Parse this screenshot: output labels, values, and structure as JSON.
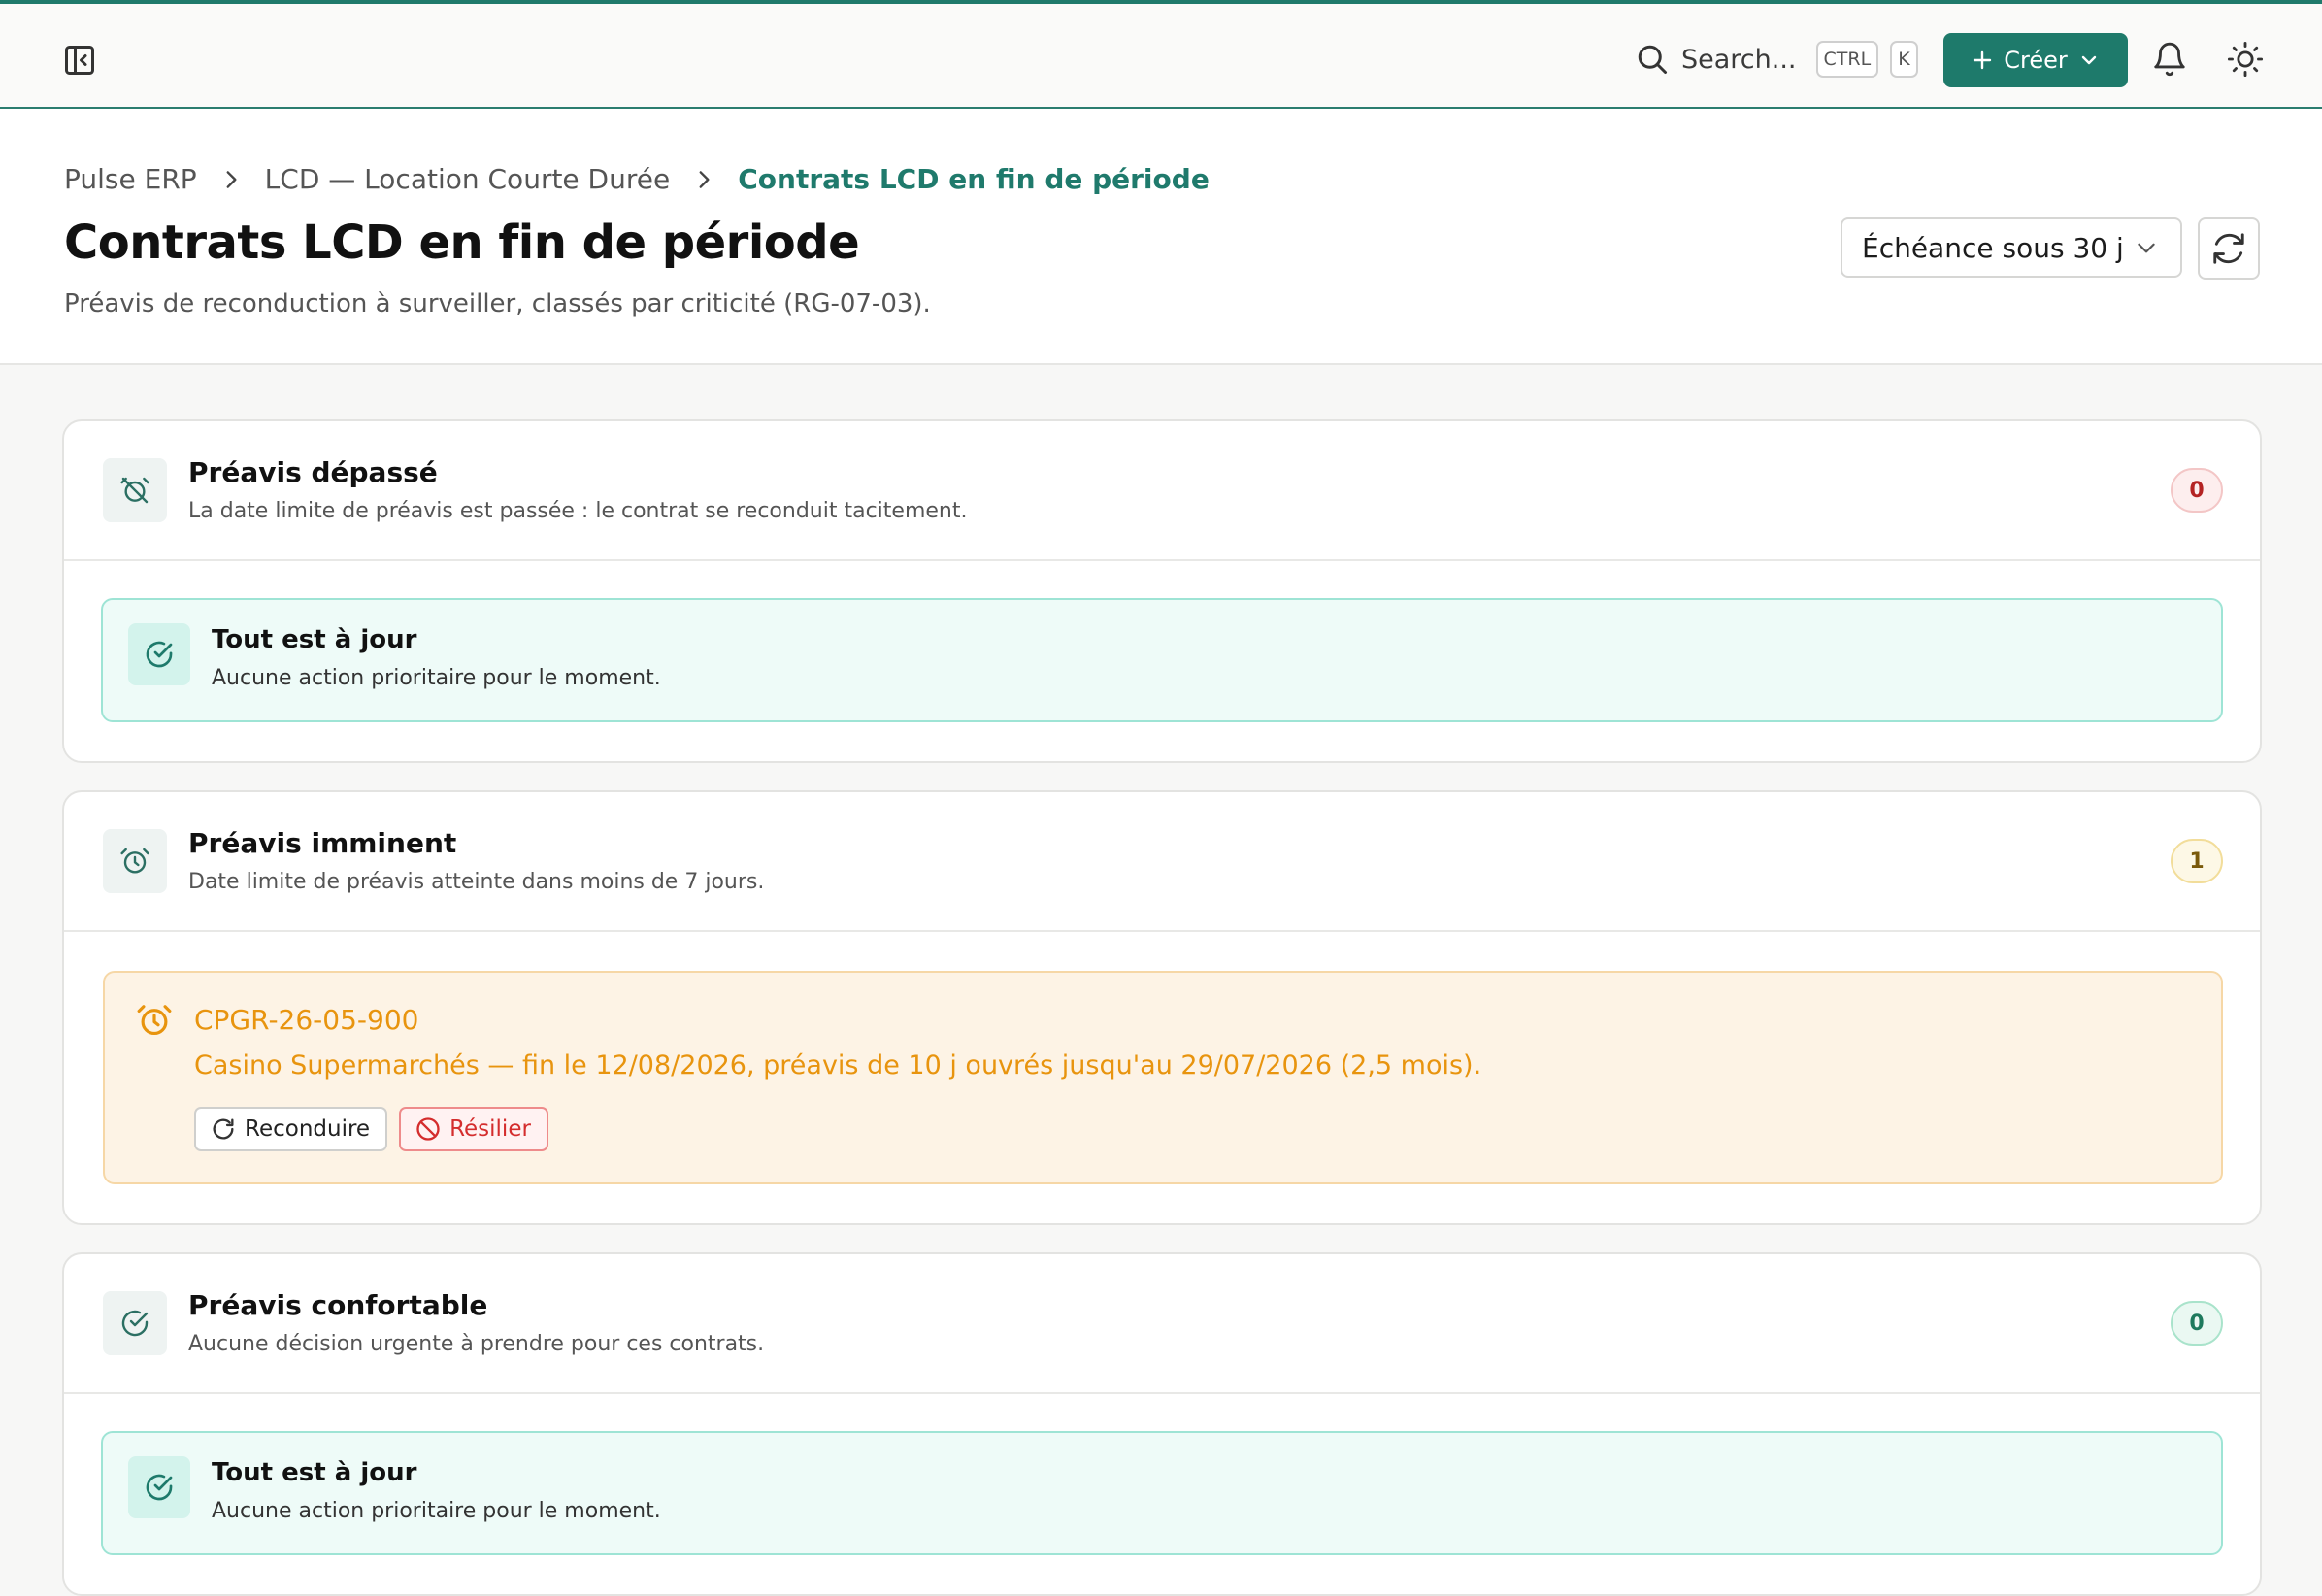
{
  "topbar": {
    "search_label": "Search...",
    "shortcut_key1": "CTRL",
    "shortcut_key2": "K",
    "create_label": "Créer"
  },
  "breadcrumb": {
    "items": [
      "Pulse ERP",
      "LCD — Location Courte Durée",
      "Contrats LCD en fin de période"
    ]
  },
  "page": {
    "title": "Contrats LCD en fin de période",
    "subtitle": "Préavis de reconduction à surveiller, classés par criticité (RG-07-03).",
    "period_filter": "Échéance sous 30 j"
  },
  "sections": [
    {
      "title": "Préavis dépassé",
      "description": "La date limite de préavis est passée : le contrat se reconduit tacitement.",
      "count": "0",
      "empty_title": "Tout est à jour",
      "empty_desc": "Aucune action prioritaire pour le moment."
    },
    {
      "title": "Préavis imminent",
      "description": "Date limite de préavis atteinte dans moins de 7 jours.",
      "count": "1",
      "items": [
        {
          "code": "CPGR-26-05-900",
          "details": "Casino Supermarchés — fin le 12/08/2026, préavis de 10 j ouvrés jusqu'au 29/07/2026 (2,5 mois).",
          "renew_label": "Reconduire",
          "terminate_label": "Résilier"
        }
      ]
    },
    {
      "title": "Préavis confortable",
      "description": "Aucune décision urgente à prendre pour ces contrats.",
      "count": "0",
      "empty_title": "Tout est à jour",
      "empty_desc": "Aucune action prioritaire pour le moment."
    }
  ],
  "colors": {
    "accent": "#1e7a6b",
    "warning": "#e8940e",
    "danger": "#d42d2d"
  }
}
